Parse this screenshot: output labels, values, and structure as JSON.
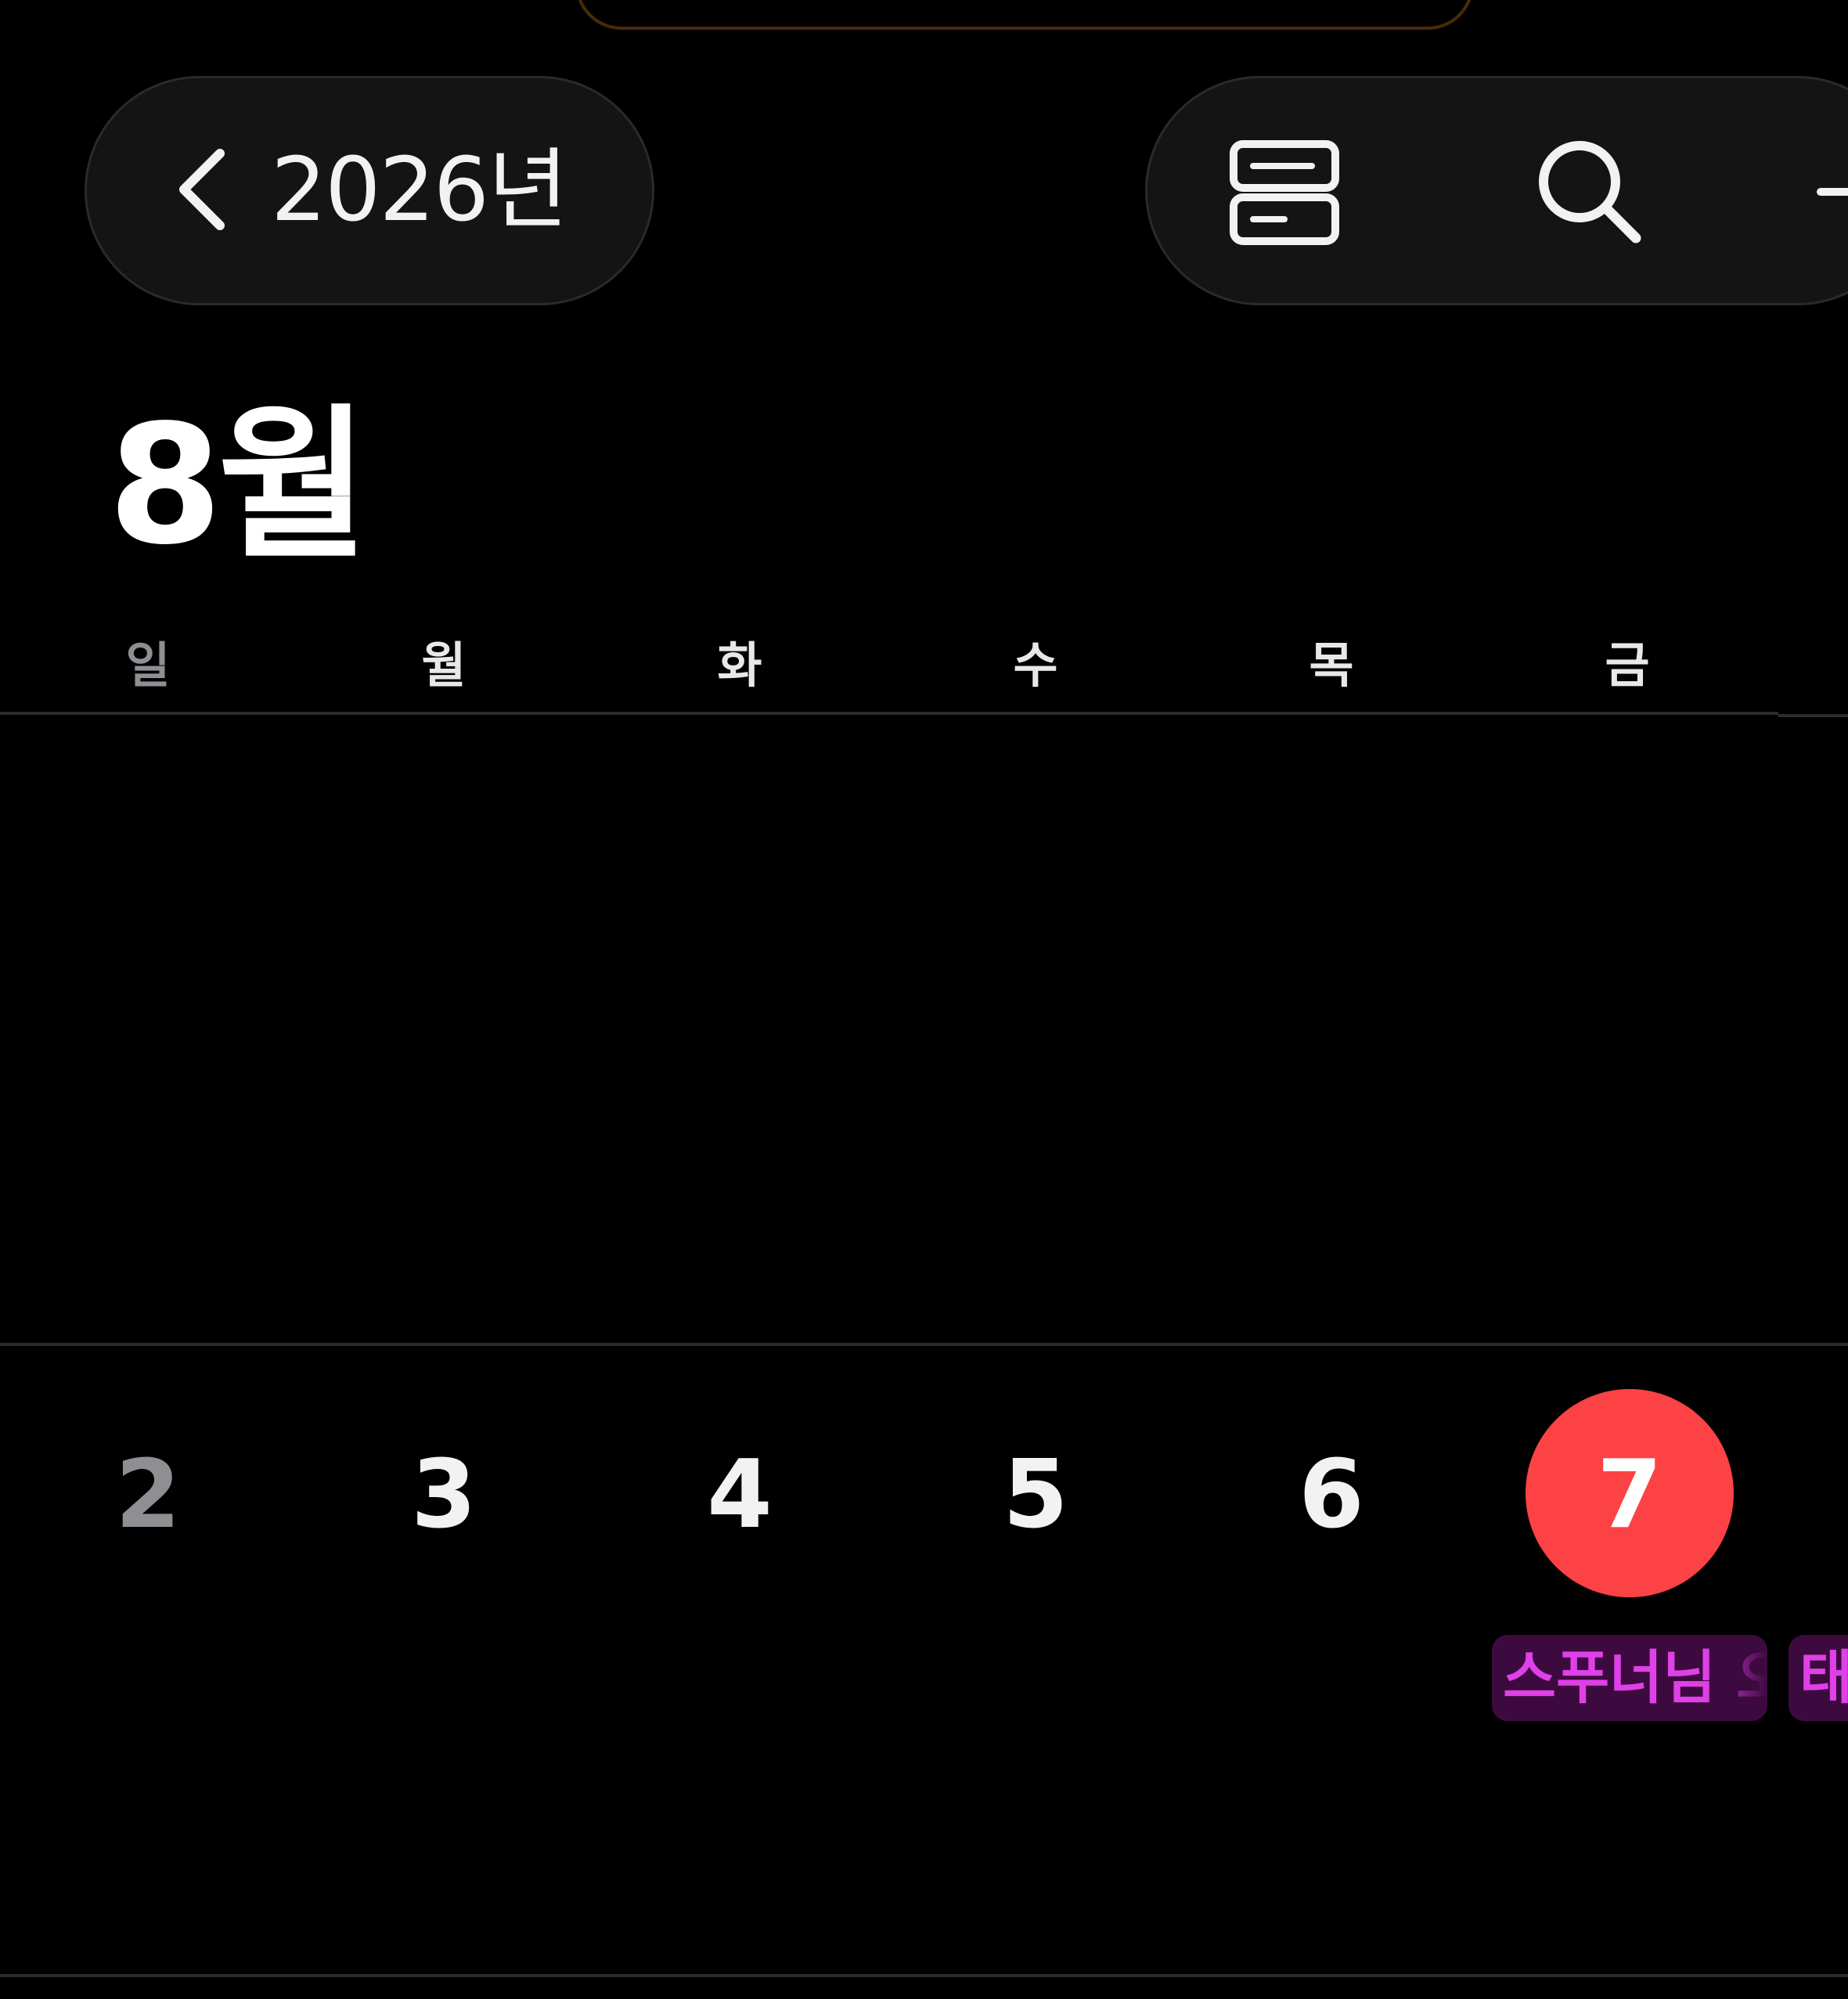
{
  "header": {
    "year_label": "2026년"
  },
  "month": {
    "title": "8월"
  },
  "weekdays": [
    "일",
    "월",
    "화",
    "수",
    "목",
    "금"
  ],
  "week": {
    "days": [
      "2",
      "3",
      "4",
      "5",
      "6",
      "7"
    ],
    "today_index": 5
  },
  "events": [
    {
      "label": "스푸너님 오",
      "day": "7"
    },
    {
      "label": "태",
      "day": "8"
    }
  ],
  "icons": {
    "back": "chevron-left-icon",
    "list_view": "list-view-icon",
    "search": "search-icon",
    "add": "plus-icon"
  },
  "colors": {
    "background": "#000000",
    "pill_background": "#141414",
    "today_accent": "#fc4245",
    "event_background": "#3d0a3f",
    "event_text": "#e040e8",
    "sunday_text": "#8e8e93",
    "divider": "#2c2c2e"
  }
}
